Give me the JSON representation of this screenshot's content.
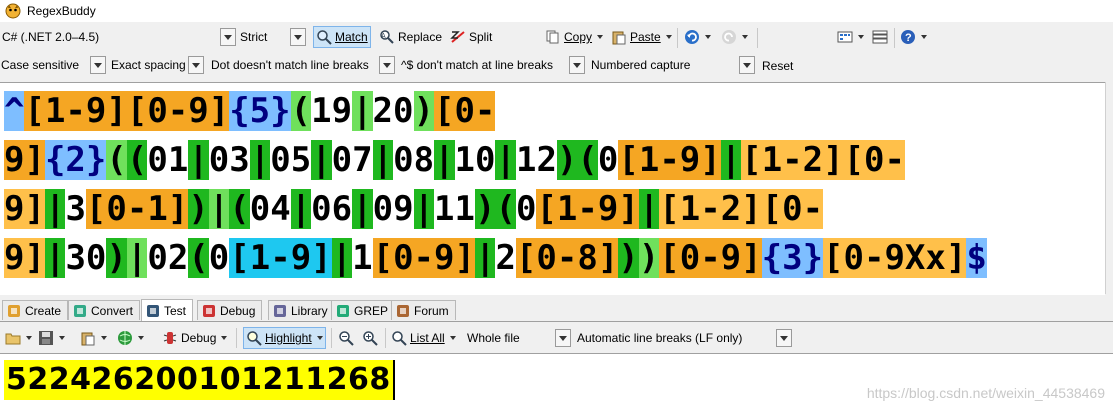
{
  "window": {
    "title": "RegexBuddy"
  },
  "toolbar1": {
    "flavor": "C# (.NET 2.0–4.5)",
    "mode": "Strict",
    "match_label": "Match",
    "replace_label": "Replace",
    "split_label": "Split",
    "copy_label": "Copy",
    "paste_label": "Paste"
  },
  "options": {
    "case": "Case sensitive",
    "spacing": "Exact spacing",
    "dot": "Dot doesn't match line breaks",
    "anchors": "^$ don't match at line breaks",
    "capture": "Numbered capture",
    "reset": "Reset"
  },
  "regex_lines": [
    [
      [
        "an",
        "^"
      ],
      [
        "cl",
        "[1-9]"
      ],
      [
        "cl",
        "[0-9]"
      ],
      [
        "q",
        "{5}"
      ],
      [
        "g1",
        "("
      ],
      [
        "lit",
        "19"
      ],
      [
        "g1",
        "|"
      ],
      [
        "lit",
        "20"
      ],
      [
        "g1",
        ")"
      ],
      [
        "cl",
        "[0-"
      ]
    ],
    [
      [
        "cl",
        "9]"
      ],
      [
        "q",
        "{2}"
      ],
      [
        "g1",
        "("
      ],
      [
        "g2",
        "("
      ],
      [
        "lit",
        "01"
      ],
      [
        "g2",
        "|"
      ],
      [
        "lit",
        "03"
      ],
      [
        "g2",
        "|"
      ],
      [
        "lit",
        "05"
      ],
      [
        "g2",
        "|"
      ],
      [
        "lit",
        "07"
      ],
      [
        "g2",
        "|"
      ],
      [
        "lit",
        "08"
      ],
      [
        "g2",
        "|"
      ],
      [
        "lit",
        "10"
      ],
      [
        "g2",
        "|"
      ],
      [
        "lit",
        "12"
      ],
      [
        "g2",
        ")"
      ],
      [
        "g2",
        "("
      ],
      [
        "lit",
        "0"
      ],
      [
        "cl",
        "[1-9]"
      ],
      [
        "g2",
        "|"
      ],
      [
        "cl2",
        "[1-2]"
      ],
      [
        "cl2",
        "[0-"
      ]
    ],
    [
      [
        "cl2",
        "9]"
      ],
      [
        "g2",
        "|"
      ],
      [
        "lit",
        "3"
      ],
      [
        "cl",
        "[0-1]"
      ],
      [
        "g2",
        ")"
      ],
      [
        "g1",
        "|"
      ],
      [
        "g2",
        "("
      ],
      [
        "lit",
        "04"
      ],
      [
        "g2",
        "|"
      ],
      [
        "lit",
        "06"
      ],
      [
        "g2",
        "|"
      ],
      [
        "lit",
        "09"
      ],
      [
        "g2",
        "|"
      ],
      [
        "lit",
        "11"
      ],
      [
        "g2",
        ")"
      ],
      [
        "g2",
        "("
      ],
      [
        "lit",
        "0"
      ],
      [
        "cl",
        "[1-9]"
      ],
      [
        "g2",
        "|"
      ],
      [
        "cl2",
        "[1-2]"
      ],
      [
        "cl2",
        "[0-"
      ]
    ],
    [
      [
        "cl2",
        "9]"
      ],
      [
        "g2",
        "|"
      ],
      [
        "lit",
        "30"
      ],
      [
        "g2",
        ")"
      ],
      [
        "g1",
        "|"
      ],
      [
        "lit",
        "02"
      ],
      [
        "g2",
        "("
      ],
      [
        "lit",
        "0"
      ],
      [
        "clb",
        "[1-9]"
      ],
      [
        "g2",
        "|"
      ],
      [
        "lit",
        "1"
      ],
      [
        "cl",
        "[0-9]"
      ],
      [
        "g2",
        "|"
      ],
      [
        "lit",
        "2"
      ],
      [
        "cl",
        "[0-8]"
      ],
      [
        "g2",
        ")"
      ],
      [
        "g1",
        ")"
      ],
      [
        "cl",
        "[0-9]"
      ],
      [
        "q",
        "{3}"
      ],
      [
        "cl2",
        "[0-9Xx]"
      ],
      [
        "an",
        "$"
      ]
    ]
  ],
  "tabs": [
    {
      "label": "Create",
      "icon": "create-icon"
    },
    {
      "label": "Convert",
      "icon": "convert-icon"
    },
    {
      "label": "Test",
      "icon": "test-icon",
      "active": true
    },
    {
      "label": "Debug",
      "icon": "debug-icon"
    },
    {
      "label": "Library",
      "icon": "library-icon"
    },
    {
      "label": "GREP",
      "icon": "grep-icon"
    },
    {
      "label": "Forum",
      "icon": "forum-icon"
    }
  ],
  "toolbar3": {
    "debug_label": "Debug",
    "highlight_label": "Highlight",
    "list_all_label": "List All",
    "scope": "Whole file",
    "line_breaks": "Automatic line breaks (LF only)"
  },
  "test": {
    "subject": "522426200101211268"
  },
  "watermark": "https://blog.csdn.net/weixin_44538469"
}
